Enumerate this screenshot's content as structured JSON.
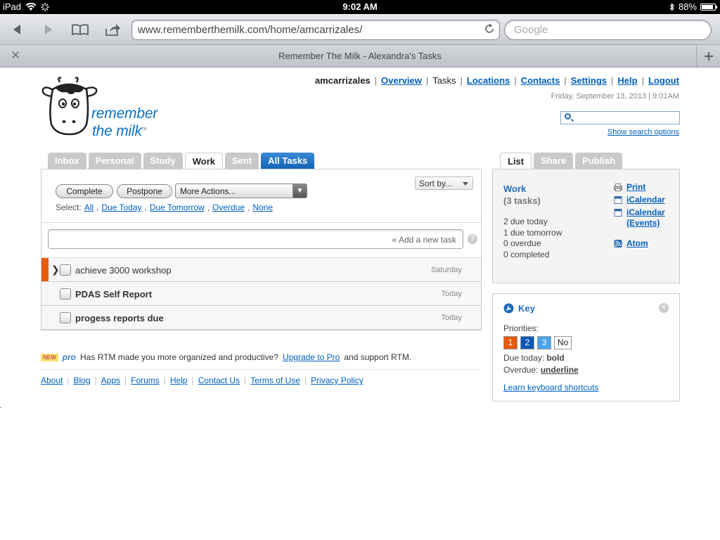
{
  "status_bar": {
    "device": "iPad",
    "time": "9:02 AM",
    "battery": "88%",
    "battery_level": 0.88
  },
  "browser": {
    "url": "www.rememberthemilk.com/home/amcarrizales/",
    "search_placeholder": "Google",
    "tab_title": "Remember The Milk - Alexandra's Tasks"
  },
  "header": {
    "logo_line1": "remember",
    "logo_line2": "the milk",
    "logo_tm": "TM",
    "username": "amcarrizales",
    "nav": {
      "overview": "Overview",
      "tasks": "Tasks",
      "locations": "Locations",
      "contacts": "Contacts",
      "settings": "Settings",
      "help": "Help",
      "logout": "Logout"
    },
    "separator": "|",
    "date": "Friday, September 13, 2013 | 9:01AM",
    "search_options": "Show search options"
  },
  "list_tabs": [
    "Inbox",
    "Personal",
    "Study",
    "Work",
    "Sent",
    "All Tasks"
  ],
  "actions": {
    "complete": "Complete",
    "postpone": "Postpone",
    "more_actions": "More Actions...",
    "sort_by": "Sort by...",
    "select_label": "Select:",
    "select_all": "All",
    "select_due_today": "Due Today",
    "select_due_tomorrow": "Due Tomorrow",
    "select_overdue": "Overdue",
    "select_none": "None",
    "add_task": "« Add a new task",
    "help": "?"
  },
  "tasks": [
    {
      "name": "achieve 3000 workshop",
      "due": "Saturday",
      "bold": false,
      "priority_color": "#e8590c"
    },
    {
      "name": "PDAS Self Report",
      "due": "Today",
      "bold": true,
      "priority_color": ""
    },
    {
      "name": "progess reports due",
      "due": "Today",
      "bold": true,
      "priority_color": ""
    }
  ],
  "promo": {
    "badge": "NEW",
    "pro": "pro",
    "text_before": "Has RTM made you more organized and productive?",
    "link": "Upgrade to Pro",
    "text_after": "and support RTM."
  },
  "footer": [
    "About",
    "Blog",
    "Apps",
    "Forums",
    "Help",
    "Contact Us",
    "Terms of Use",
    "Privacy Policy"
  ],
  "right_tabs": [
    "List",
    "Share",
    "Publish"
  ],
  "list_info": {
    "name": "Work",
    "count": "(3 tasks)",
    "stats": [
      "2 due today",
      "1 due tomorrow",
      "0 overdue",
      "0 completed"
    ],
    "links": {
      "print": "Print",
      "icalendar": "iCalendar",
      "icalendar_events_1": "iCalendar",
      "icalendar_events_2": "(Events)",
      "atom": "Atom"
    }
  },
  "key": {
    "title": "Key",
    "priorities_label": "Priorities:",
    "priorities": [
      {
        "label": "1",
        "color": "#e8590c"
      },
      {
        "label": "2",
        "color": "#0a58b8"
      },
      {
        "label": "3",
        "color": "#4aa3ef"
      }
    ],
    "no_priority": "No",
    "due_today_label": "Due today:",
    "due_today_value": "bold",
    "overdue_label": "Overdue:",
    "overdue_value": "underline",
    "shortcuts": "Learn keyboard shortcuts"
  },
  "colors": {
    "link": "#0060bf",
    "brand": "#0a72c9",
    "all_tasks_tab": "#1464b4",
    "priority_1": "#e8590c",
    "priority_2": "#0a58b8",
    "priority_3": "#4aa3ef"
  }
}
